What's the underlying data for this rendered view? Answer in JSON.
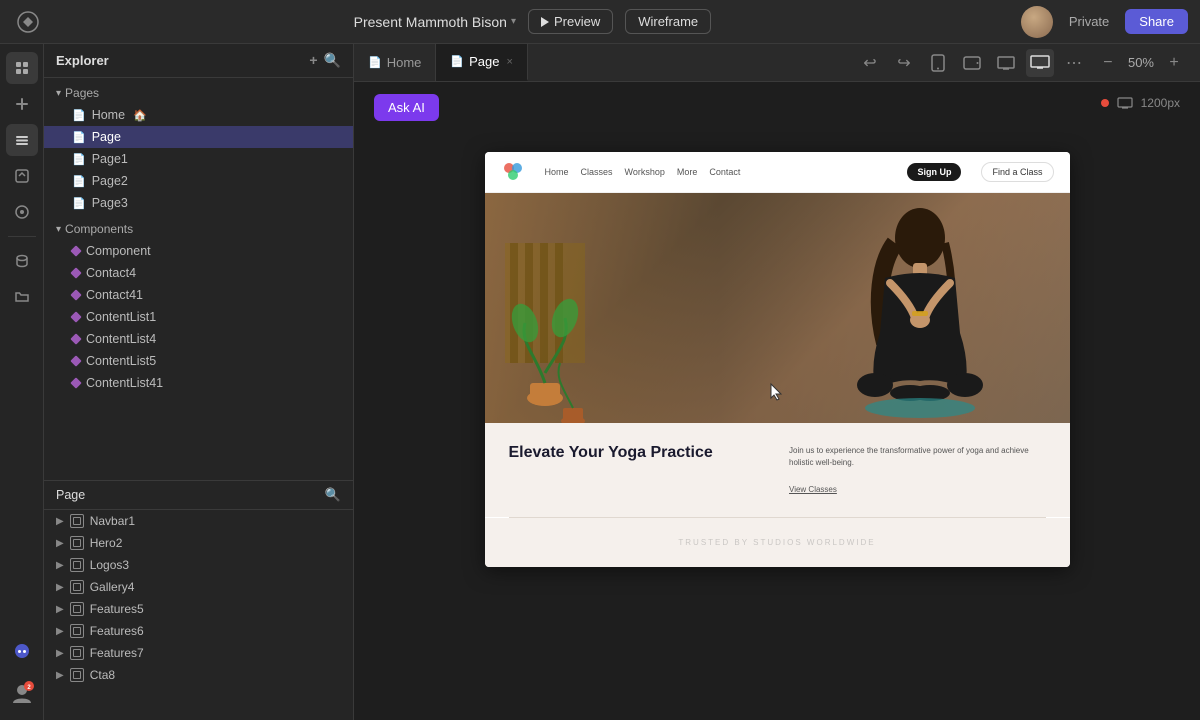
{
  "topbar": {
    "project_name": "Present Mammoth Bison",
    "chevron": "▾",
    "preview_label": "Preview",
    "wireframe_label": "Wireframe",
    "private_label": "Private",
    "share_label": "Share"
  },
  "explorer": {
    "title": "Explorer",
    "add_icon": "+",
    "search_icon": "⌕",
    "pages_section": "Pages",
    "pages": [
      {
        "label": "Home",
        "has_home_icon": true
      },
      {
        "label": "Page",
        "active": true
      },
      {
        "label": "Page1"
      },
      {
        "label": "Page2"
      },
      {
        "label": "Page3"
      }
    ],
    "components_section": "Components",
    "components": [
      {
        "label": "Component"
      },
      {
        "label": "Contact4"
      },
      {
        "label": "Contact41"
      },
      {
        "label": "ContentList1"
      },
      {
        "label": "ContentList4"
      },
      {
        "label": "ContentList5"
      },
      {
        "label": "ContentList41"
      }
    ]
  },
  "layers": {
    "title": "Page",
    "search_icon": "⌕",
    "items": [
      {
        "label": "Navbar1"
      },
      {
        "label": "Hero2"
      },
      {
        "label": "Logos3"
      },
      {
        "label": "Gallery4"
      },
      {
        "label": "Features5"
      },
      {
        "label": "Features6"
      },
      {
        "label": "Features7"
      },
      {
        "label": "Cta8"
      }
    ]
  },
  "tabs": [
    {
      "label": "Home",
      "active": false
    },
    {
      "label": "Page",
      "active": true,
      "closable": true
    }
  ],
  "toolbar": {
    "undo_label": "↩",
    "redo_label": "↪",
    "mobile_icon": "📱",
    "tablet_icon": "⬜",
    "desktop_small_icon": "🖥",
    "desktop_icon": "🖥",
    "more_icon": "⋯",
    "zoom_minus": "−",
    "zoom_level": "50%",
    "zoom_plus": "+"
  },
  "canvas": {
    "ask_ai_label": "Ask AI",
    "resolution": "1200px",
    "error_dot": true
  },
  "page_preview": {
    "navbar": {
      "links": [
        "Home",
        "Classes",
        "Workshop",
        "More",
        "Contact"
      ],
      "signup_label": "Sign Up",
      "class_label": "Find a Class"
    },
    "hero": {
      "alt": "Woman in yoga meditation pose"
    },
    "content": {
      "title": "Elevate Your Yoga Practice",
      "description": "Join us to experience the transformative power of yoga and achieve holistic well-being.",
      "link_label": "View Classes"
    }
  },
  "icons": {
    "logo": "◈",
    "pages_icon": "📄",
    "component_icon": "◇",
    "layer_icon": "≡",
    "style_icon": "◻",
    "asset_icon": "▦",
    "data_icon": "⊙",
    "folder_icon": "📁",
    "discord_icon": "◉"
  }
}
